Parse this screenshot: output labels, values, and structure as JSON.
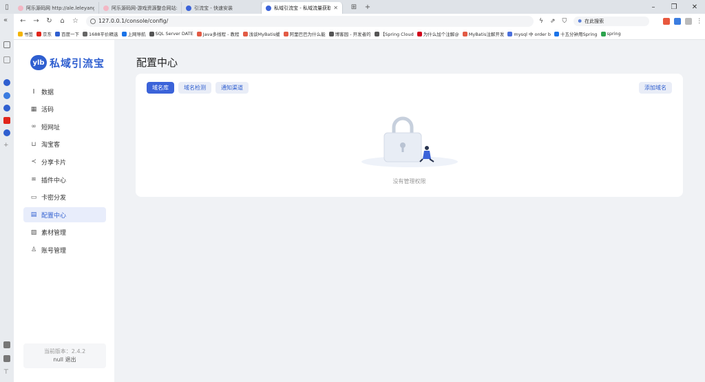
{
  "browser": {
    "tabs": [
      {
        "label": "阿乐源码网 http://ale.leleyangyu",
        "color": "#f3b7c4"
      },
      {
        "label": "阿乐源码网-游戏资源整合网站:免",
        "color": "#f3b7c4"
      },
      {
        "label": "引流宝 - 快速安装",
        "color": "#3b63d9"
      },
      {
        "label": "私域引流宝 - 私域流量获取与",
        "color": "#3b63d9"
      }
    ],
    "url": "127.0.0.1/console/config/",
    "search_placeholder": "在此搜索",
    "bookmarks": [
      {
        "label": "书签",
        "color": "#f4b400"
      },
      {
        "label": "京东",
        "color": "#e1251b"
      },
      {
        "label": "百度一下",
        "color": "#2f5fd0"
      },
      {
        "label": "1688平价精选",
        "color": "#666666"
      },
      {
        "label": "上网导航",
        "color": "#1a73e8"
      },
      {
        "label": "SQL Server DATE",
        "color": "#555555"
      },
      {
        "label": "Java多线程 - 教程",
        "color": "#e25b45"
      },
      {
        "label": "浅谈MyBatis缓",
        "color": "#e25b45"
      },
      {
        "label": "阿里巴巴为什么能",
        "color": "#e25b45"
      },
      {
        "label": "博客园 - 开发者的",
        "color": "#555555"
      },
      {
        "label": "【Spring Cloud",
        "color": "#555555"
      },
      {
        "label": "为什么加个注解@",
        "color": "#d0021b"
      },
      {
        "label": "MyBatis注解开发",
        "color": "#e25b45"
      },
      {
        "label": "mysql 中 order b",
        "color": "#4a6fdc"
      },
      {
        "label": "十五分钟用Spring",
        "color": "#1a73e8"
      },
      {
        "label": "spring",
        "color": "#2da44e"
      }
    ]
  },
  "app": {
    "logo_badge": "ylb",
    "logo_text": "私域引流宝",
    "menu": [
      {
        "label": "数据",
        "icon": "bar-chart-icon",
        "glyph": "⫾",
        "active": false
      },
      {
        "label": "活码",
        "icon": "qrcode-icon",
        "glyph": "▦",
        "active": false
      },
      {
        "label": "短网址",
        "icon": "link-icon",
        "glyph": "∞",
        "active": false
      },
      {
        "label": "淘宝客",
        "icon": "cart-icon",
        "glyph": "⊔",
        "active": false
      },
      {
        "label": "分享卡片",
        "icon": "share-icon",
        "glyph": "≺",
        "active": false
      },
      {
        "label": "插件中心",
        "icon": "layers-icon",
        "glyph": "≋",
        "active": false
      },
      {
        "label": "卡密分发",
        "icon": "folder-icon",
        "glyph": "▭",
        "active": false
      },
      {
        "label": "配置中心",
        "icon": "config-icon",
        "glyph": "▤",
        "active": true
      },
      {
        "label": "素材管理",
        "icon": "image-icon",
        "glyph": "▨",
        "active": false
      },
      {
        "label": "账号管理",
        "icon": "user-icon",
        "glyph": "♙",
        "active": false
      }
    ],
    "version_label": "当前版本：2.4.2",
    "user_label": "null 退出",
    "page_title": "配置中心",
    "tabs": [
      {
        "label": "域名库",
        "active": true
      },
      {
        "label": "域名检测",
        "active": false
      },
      {
        "label": "通知渠道",
        "active": false
      }
    ],
    "add_button": "添加域名",
    "empty_text": "没有管理权限"
  }
}
